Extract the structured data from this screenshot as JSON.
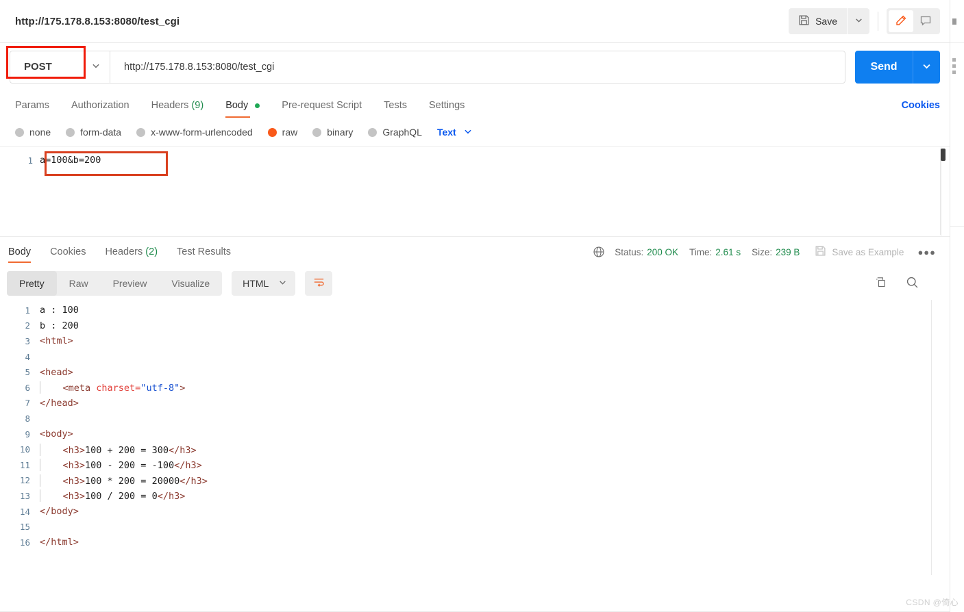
{
  "header": {
    "request_title": "http://175.178.8.153:8080/test_cgi",
    "save_label": "Save",
    "save_icon": "floppy-disk-icon",
    "save_caret_icon": "chevron-down-icon",
    "edit_icon": "pencil-icon",
    "comment_icon": "comment-icon"
  },
  "url_row": {
    "method": "POST",
    "method_caret_icon": "chevron-down-icon",
    "url": "http://175.178.8.153:8080/test_cgi",
    "send_label": "Send",
    "send_caret_icon": "chevron-down-icon"
  },
  "request_tabs": [
    {
      "label": "Params",
      "active": false
    },
    {
      "label": "Authorization",
      "active": false
    },
    {
      "label": "Headers",
      "count": "(9)",
      "active": false
    },
    {
      "label": "Body",
      "active": true,
      "dot": true
    },
    {
      "label": "Pre-request Script",
      "active": false
    },
    {
      "label": "Tests",
      "active": false
    },
    {
      "label": "Settings",
      "active": false
    }
  ],
  "cookies_link": "Cookies",
  "body_types": [
    {
      "label": "none",
      "selected": false
    },
    {
      "label": "form-data",
      "selected": false
    },
    {
      "label": "x-www-form-urlencoded",
      "selected": false
    },
    {
      "label": "raw",
      "selected": true
    },
    {
      "label": "binary",
      "selected": false
    },
    {
      "label": "GraphQL",
      "selected": false
    }
  ],
  "body_format": {
    "label": "Text",
    "caret_icon": "chevron-down-icon"
  },
  "request_body": {
    "lines": [
      {
        "no": "1",
        "text": "a=100&b=200"
      }
    ]
  },
  "response_tabs": [
    {
      "label": "Body",
      "active": true
    },
    {
      "label": "Cookies",
      "active": false
    },
    {
      "label": "Headers",
      "count": "(2)",
      "active": false
    },
    {
      "label": "Test Results",
      "active": false
    }
  ],
  "response_status": {
    "globe_icon": "globe-icon",
    "status_label": "Status:",
    "status_value": "200 OK",
    "time_label": "Time:",
    "time_value": "2.61 s",
    "size_label": "Size:",
    "size_value": "239 B",
    "save_example_icon": "floppy-disk-icon",
    "save_example_label": "Save as Example",
    "more_icon": "ellipsis-icon",
    "status_color": "#1f8b4c"
  },
  "response_toolbar": {
    "views": [
      {
        "label": "Pretty",
        "active": true
      },
      {
        "label": "Raw",
        "active": false
      },
      {
        "label": "Preview",
        "active": false
      },
      {
        "label": "Visualize",
        "active": false
      }
    ],
    "format": "HTML",
    "format_caret_icon": "chevron-down-icon",
    "wrap_icon": "word-wrap-icon",
    "copy_icon": "copy-icon",
    "search_icon": "search-icon"
  },
  "response_body": {
    "lines": [
      {
        "no": "1",
        "segments": [
          {
            "t": "a : 100",
            "c": "plain"
          }
        ],
        "indent": false
      },
      {
        "no": "2",
        "segments": [
          {
            "t": "b : 200",
            "c": "plain"
          }
        ],
        "indent": false
      },
      {
        "no": "3",
        "segments": [
          {
            "t": "<html>",
            "c": "tag"
          }
        ],
        "indent": false
      },
      {
        "no": "4",
        "segments": [],
        "indent": false
      },
      {
        "no": "5",
        "segments": [
          {
            "t": "<head>",
            "c": "tag"
          }
        ],
        "indent": false
      },
      {
        "no": "6",
        "segments": [
          {
            "t": "    <meta ",
            "c": "tag"
          },
          {
            "t": "charset=",
            "c": "attr"
          },
          {
            "t": "\"utf-8\"",
            "c": "val"
          },
          {
            "t": ">",
            "c": "tag"
          }
        ],
        "indent": true
      },
      {
        "no": "7",
        "segments": [
          {
            "t": "</head>",
            "c": "tag"
          }
        ],
        "indent": false
      },
      {
        "no": "8",
        "segments": [],
        "indent": false
      },
      {
        "no": "9",
        "segments": [
          {
            "t": "<body>",
            "c": "tag"
          }
        ],
        "indent": false
      },
      {
        "no": "10",
        "segments": [
          {
            "t": "    <h3>",
            "c": "tag"
          },
          {
            "t": "100 + 200 = 300",
            "c": "plain"
          },
          {
            "t": "</h3>",
            "c": "tag"
          }
        ],
        "indent": true
      },
      {
        "no": "11",
        "segments": [
          {
            "t": "    <h3>",
            "c": "tag"
          },
          {
            "t": "100 - 200 = -100",
            "c": "plain"
          },
          {
            "t": "</h3>",
            "c": "tag"
          }
        ],
        "indent": true
      },
      {
        "no": "12",
        "segments": [
          {
            "t": "    <h3>",
            "c": "tag"
          },
          {
            "t": "100 * 200 = 20000",
            "c": "plain"
          },
          {
            "t": "</h3>",
            "c": "tag"
          }
        ],
        "indent": true
      },
      {
        "no": "13",
        "segments": [
          {
            "t": "    <h3>",
            "c": "tag"
          },
          {
            "t": "100 / 200 = 0",
            "c": "plain"
          },
          {
            "t": "</h3>",
            "c": "tag"
          }
        ],
        "indent": true
      },
      {
        "no": "14",
        "segments": [
          {
            "t": "</body>",
            "c": "tag"
          }
        ],
        "indent": false
      },
      {
        "no": "15",
        "segments": [],
        "indent": false
      },
      {
        "no": "16",
        "segments": [
          {
            "t": "</html>",
            "c": "tag"
          }
        ],
        "indent": false
      }
    ]
  },
  "annotations": {
    "method_box_color": "#f01c0a",
    "body_box_color": "#d9401f"
  },
  "watermark": "CSDN @倚心"
}
